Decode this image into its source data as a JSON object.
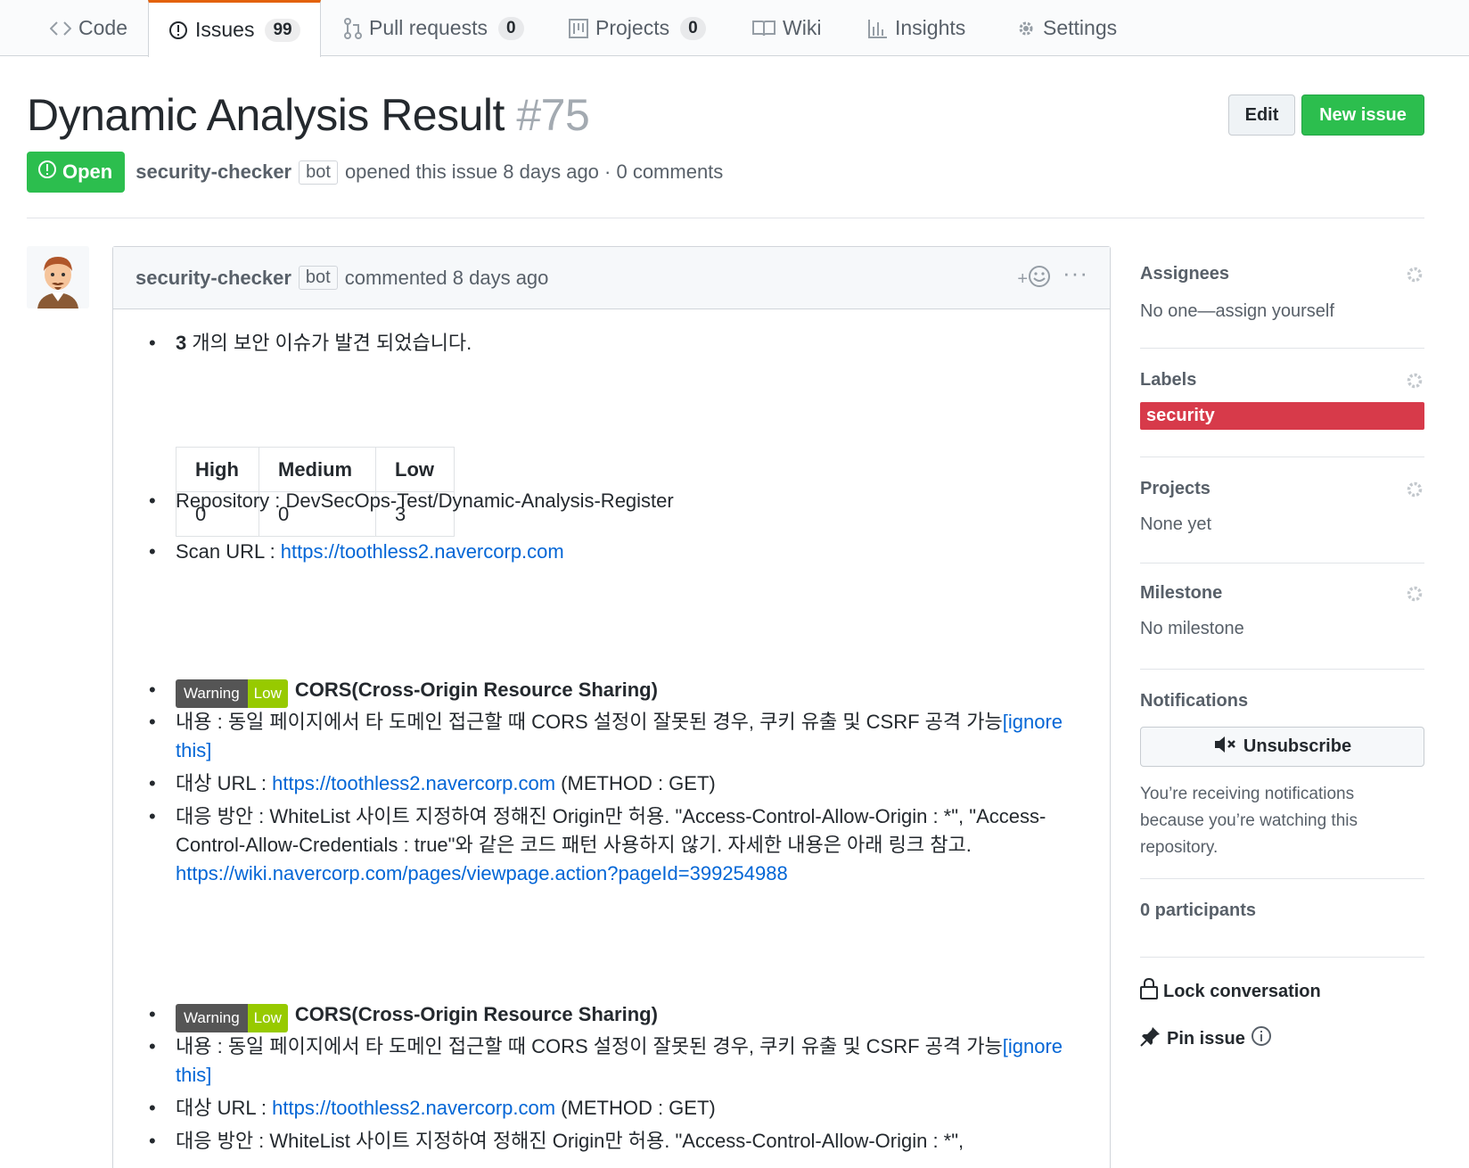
{
  "tabs": [
    {
      "label": "Code",
      "icon": "code-icon"
    },
    {
      "label": "Issues",
      "count": "99",
      "icon": "issue-opened-icon"
    },
    {
      "label": "Pull requests",
      "count": "0",
      "icon": "git-pull-request-icon"
    },
    {
      "label": "Projects",
      "count": "0",
      "icon": "project-icon"
    },
    {
      "label": "Wiki",
      "icon": "book-icon"
    },
    {
      "label": "Insights",
      "icon": "graph-icon"
    },
    {
      "label": "Settings",
      "icon": "gear-icon"
    }
  ],
  "issue": {
    "title": "Dynamic Analysis Result",
    "number": "#75",
    "state": "Open",
    "author": "security-checker",
    "bot_label": "bot",
    "opened_text": "opened this issue 8 days ago · 0 comments"
  },
  "buttons": {
    "edit": "Edit",
    "new_issue": "New issue"
  },
  "comment": {
    "author": "security-checker",
    "bot_label": "bot",
    "time": "commented 8 days ago",
    "summary_count": "3",
    "summary_text": " 개의 보안 이슈가 발견 되었습니다.",
    "table": {
      "headers": [
        "High",
        "Medium",
        "Low"
      ],
      "values": [
        "0",
        "0",
        "3"
      ]
    },
    "repository_label": "Repository : ",
    "repository": "DevSecOps-Test/Dynamic-Analysis-Register",
    "scan_url_label": "Scan URL : ",
    "scan_url": "https://toothless2.navercorp.com",
    "findings": [
      {
        "badge_type": "Warning",
        "badge_level": "Low",
        "title": "CORS(Cross-Origin Resource Sharing)",
        "content": "내용 : 동일 페이지에서 타 도메인 접근할 때 CORS 설정이 잘못된 경우, 쿠키 유출 및 CSRF 공격 가능",
        "ignore": "[ignore this]",
        "target_label": "대상 URL : ",
        "target_url": "https://toothless2.navercorp.com",
        "method": " (METHOD : GET)",
        "remedy": "대응 방안 : WhiteList 사이트 지정하여 정해진 Origin만 허용. \"Access-Control-Allow-Origin : *\", \"Access-Control-Allow-Credentials : true\"와 같은 코드 패턴 사용하지 않기. 자세한 내용은 아래 링크 참고.",
        "remedy_link": "https://wiki.navercorp.com/pages/viewpage.action?pageId=399254988"
      },
      {
        "badge_type": "Warning",
        "badge_level": "Low",
        "title": "CORS(Cross-Origin Resource Sharing)",
        "content": "내용 : 동일 페이지에서 타 도메인 접근할 때 CORS 설정이 잘못된 경우, 쿠키 유출 및 CSRF 공격 가능",
        "ignore": "[ignore this]",
        "target_label": "대상 URL : ",
        "target_url": "https://toothless2.navercorp.com",
        "method": " (METHOD : GET)",
        "remedy": "대응 방안 : WhiteList 사이트 지정하여 정해진 Origin만 허용. \"Access-Control-Allow-Origin : *\","
      }
    ]
  },
  "sidebar": {
    "assignees": {
      "title": "Assignees",
      "value": "No one—assign yourself"
    },
    "labels": {
      "title": "Labels",
      "label": "security",
      "label_color": "#d73a4a"
    },
    "projects": {
      "title": "Projects",
      "value": "None yet"
    },
    "milestone": {
      "title": "Milestone",
      "value": "No milestone"
    },
    "notifications": {
      "title": "Notifications",
      "button": "Unsubscribe",
      "note": "You’re receiving notifications because you’re watching this repository."
    },
    "participants": "0 participants",
    "lock": "Lock conversation",
    "pin": "Pin issue"
  },
  "colors": {
    "accent_green": "#2cbe4e",
    "link_blue": "#0366d6",
    "tab_accent": "#e36209"
  }
}
